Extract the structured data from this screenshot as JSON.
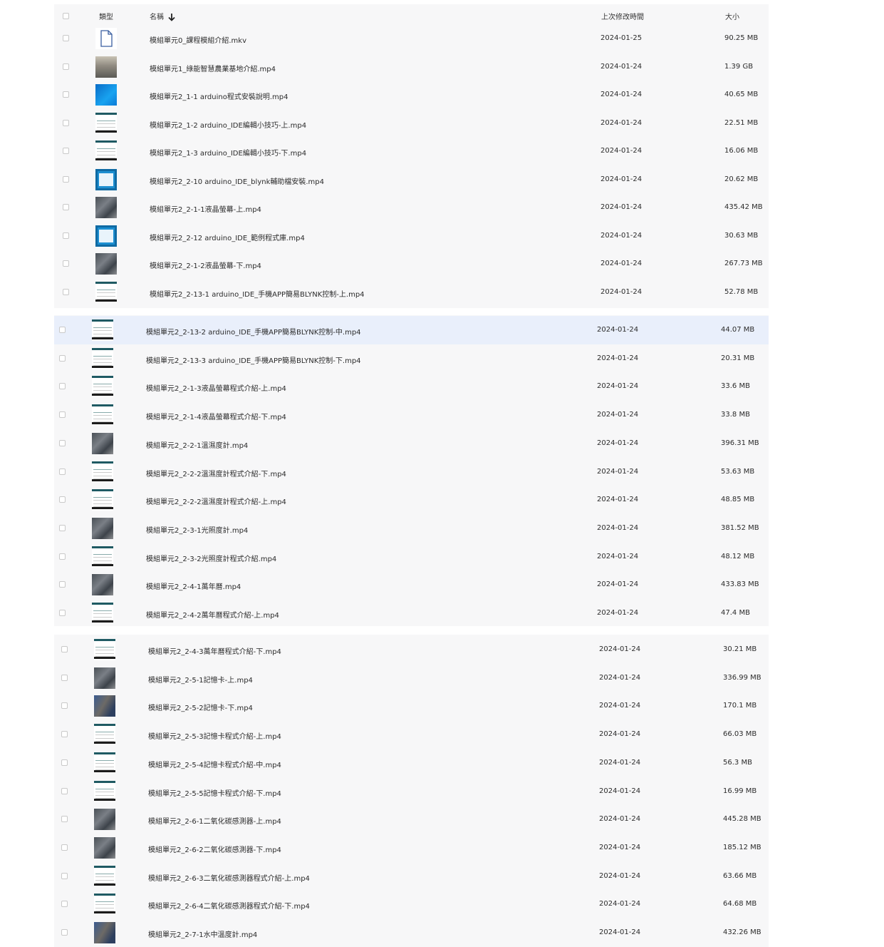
{
  "header": {
    "type_label": "類型",
    "name_label": "名稱",
    "sort_icon": "arrow-down-icon",
    "modified_label": "上次修改時間",
    "size_label": "大小"
  },
  "rows": [
    {
      "thumb": "file-icon",
      "name": "模組單元0_課程模組介紹.mkv",
      "date": "2024-01-25",
      "size": "90.25 MB"
    },
    {
      "thumb": "farm-photo",
      "name": "模組單元1_綠能智慧農業基地介紹.mp4",
      "date": "2024-01-24",
      "size": "1.39 GB"
    },
    {
      "thumb": "blue-screen",
      "name": "模組單元2_1-1 arduino程式安裝說明.mp4",
      "date": "2024-01-24",
      "size": "40.65 MB"
    },
    {
      "thumb": "code-screen",
      "name": "模組單元2_1-2 arduino_IDE編輯小技巧-上.mp4",
      "date": "2024-01-24",
      "size": "22.51 MB"
    },
    {
      "thumb": "code-screen",
      "name": "模組單元2_1-3 arduino_IDE編輯小技巧-下.mp4",
      "date": "2024-01-24",
      "size": "16.06 MB"
    },
    {
      "thumb": "window-screen",
      "name": "模組單元2_2-10 arduino_IDE_blynk輔助檔安裝.mp4",
      "date": "2024-01-24",
      "size": "20.62 MB"
    },
    {
      "thumb": "device-photo",
      "name": "模組單元2_2-1-1液晶螢幕-上.mp4",
      "date": "2024-01-24",
      "size": "435.42 MB"
    },
    {
      "thumb": "window-screen",
      "name": "模組單元2_2-12 arduino_IDE_範例程式庫.mp4",
      "date": "2024-01-24",
      "size": "30.63 MB"
    },
    {
      "thumb": "device-photo",
      "name": "模組單元2_2-1-2液晶螢幕-下.mp4",
      "date": "2024-01-24",
      "size": "267.73 MB"
    },
    {
      "thumb": "code-screen",
      "name": "模組單元2_2-13-1 arduino_IDE_手機APP簡易BLYNK控制-上.mp4",
      "date": "2024-01-24",
      "size": "52.78 MB"
    },
    {
      "thumb": "code-screen",
      "name": "模組單元2_2-13-2 arduino_IDE_手機APP簡易BLYNK控制-中.mp4",
      "date": "2024-01-24",
      "size": "44.07 MB"
    },
    {
      "thumb": "code-screen",
      "name": "模組單元2_2-13-3 arduino_IDE_手機APP簡易BLYNK控制-下.mp4",
      "date": "2024-01-24",
      "size": "20.31 MB"
    },
    {
      "thumb": "code-screen",
      "name": "模組單元2_2-1-3液晶螢幕程式介紹-上.mp4",
      "date": "2024-01-24",
      "size": "33.6 MB"
    },
    {
      "thumb": "code-screen",
      "name": "模組單元2_2-1-4液晶螢幕程式介紹-下.mp4",
      "date": "2024-01-24",
      "size": "33.8 MB"
    },
    {
      "thumb": "device-photo",
      "name": "模組單元2_2-2-1溫濕度計.mp4",
      "date": "2024-01-24",
      "size": "396.31 MB"
    },
    {
      "thumb": "code-screen",
      "name": "模組單元2_2-2-2溫濕度計程式介紹-下.mp4",
      "date": "2024-01-24",
      "size": "53.63 MB"
    },
    {
      "thumb": "code-screen",
      "name": "模組單元2_2-2-2溫濕度計程式介紹-上.mp4",
      "date": "2024-01-24",
      "size": "48.85 MB"
    },
    {
      "thumb": "device-photo",
      "name": "模組單元2_2-3-1光照度計.mp4",
      "date": "2024-01-24",
      "size": "381.52 MB"
    },
    {
      "thumb": "code-screen",
      "name": "模組單元2_2-3-2光照度計程式介紹.mp4",
      "date": "2024-01-24",
      "size": "48.12 MB"
    },
    {
      "thumb": "device-photo",
      "name": "模組單元2_2-4-1萬年曆.mp4",
      "date": "2024-01-24",
      "size": "433.83 MB"
    },
    {
      "thumb": "code-screen",
      "name": "模組單元2_2-4-2萬年曆程式介紹-上.mp4",
      "date": "2024-01-24",
      "size": "47.4 MB"
    },
    {
      "thumb": "code-screen",
      "name": "模組單元2_2-4-3萬年曆程式介紹-下.mp4",
      "date": "2024-01-24",
      "size": "30.21 MB"
    },
    {
      "thumb": "device-photo",
      "name": "模組單元2_2-5-1記憶卡-上.mp4",
      "date": "2024-01-24",
      "size": "336.99 MB"
    },
    {
      "thumb": "hand-photo",
      "name": "模組單元2_2-5-2記憶卡-下.mp4",
      "date": "2024-01-24",
      "size": "170.1 MB"
    },
    {
      "thumb": "code-screen",
      "name": "模組單元2_2-5-3記憶卡程式介紹-上.mp4",
      "date": "2024-01-24",
      "size": "66.03 MB"
    },
    {
      "thumb": "code-screen",
      "name": "模組單元2_2-5-4記憶卡程式介紹-中.mp4",
      "date": "2024-01-24",
      "size": "56.3 MB"
    },
    {
      "thumb": "code-screen",
      "name": "模組單元2_2-5-5記憶卡程式介紹-下.mp4",
      "date": "2024-01-24",
      "size": "16.99 MB"
    },
    {
      "thumb": "device-photo",
      "name": "模組單元2_2-6-1二氧化碳感測器-上.mp4",
      "date": "2024-01-24",
      "size": "445.28 MB"
    },
    {
      "thumb": "device-photo",
      "name": "模組單元2_2-6-2二氧化碳感測器-下.mp4",
      "date": "2024-01-24",
      "size": "185.12 MB"
    },
    {
      "thumb": "code-screen",
      "name": "模組單元2_2-6-3二氧化碳感測器程式介紹-上.mp4",
      "date": "2024-01-24",
      "size": "63.66 MB"
    },
    {
      "thumb": "code-screen",
      "name": "模組單元2_2-6-4二氧化碳感測器程式介紹-下.mp4",
      "date": "2024-01-24",
      "size": "64.68 MB"
    },
    {
      "thumb": "hand-photo",
      "name": "模組單元2_2-7-1水中溫度計.mp4",
      "date": "2024-01-24",
      "size": "432.26 MB"
    }
  ]
}
